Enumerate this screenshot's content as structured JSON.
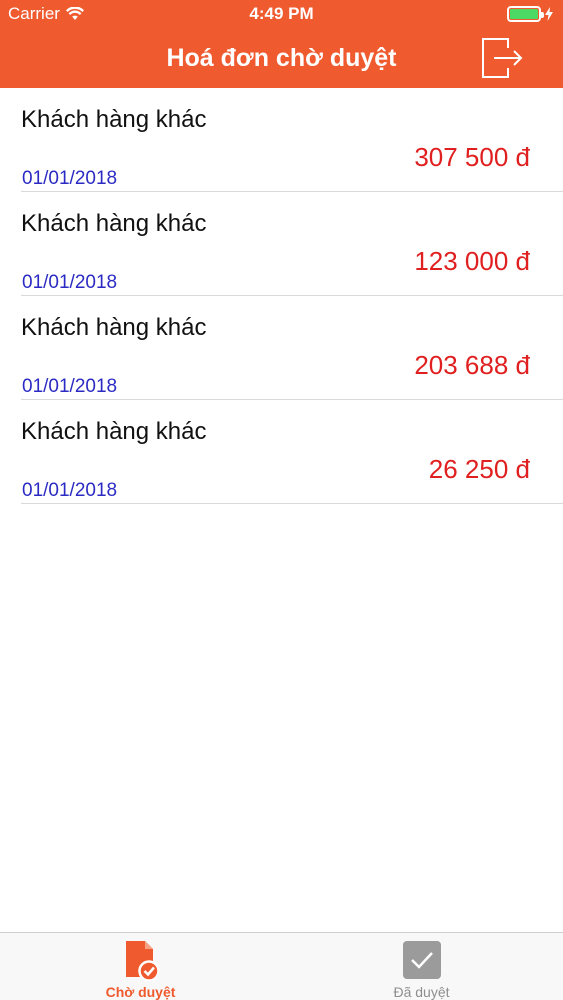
{
  "status_bar": {
    "carrier": "Carrier",
    "time": "4:49 PM"
  },
  "header": {
    "title": "Hoá đơn chờ duyệt",
    "logout_icon": "logout-icon"
  },
  "invoices": [
    {
      "customer": "Khách hàng khác",
      "date": "01/01/2018",
      "amount": "307 500 đ"
    },
    {
      "customer": "Khách hàng khác",
      "date": "01/01/2018",
      "amount": "123 000 đ"
    },
    {
      "customer": "Khách hàng khác",
      "date": "01/01/2018",
      "amount": "203 688 đ"
    },
    {
      "customer": "Khách hàng khác",
      "date": "01/01/2018",
      "amount": "26 250 đ"
    }
  ],
  "tabs": [
    {
      "label": "Chờ duyệt",
      "icon": "pending-invoice-icon",
      "active": true
    },
    {
      "label": "Đã duyệt",
      "icon": "approved-check-icon",
      "active": false
    }
  ],
  "colors": {
    "accent": "#ef5a2f",
    "amount": "#e02020",
    "date": "#2b2bc4",
    "battery": "#4cd964"
  }
}
